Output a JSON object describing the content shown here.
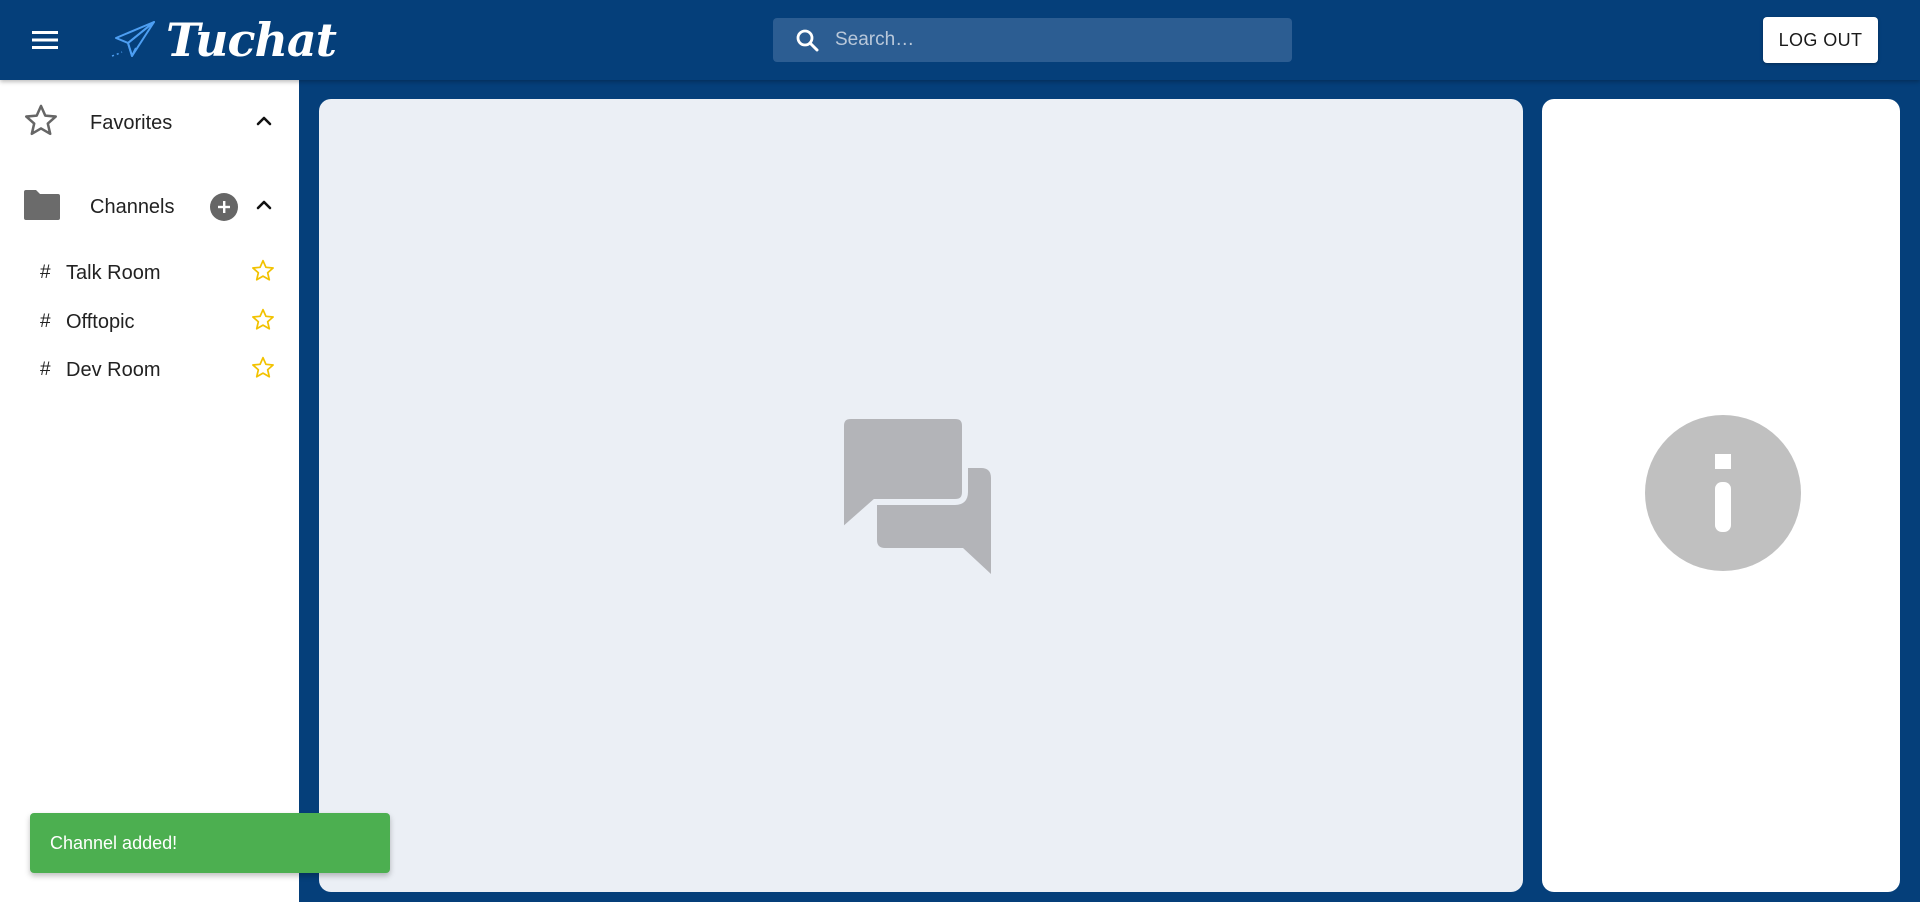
{
  "app": {
    "name": "Tuchat",
    "brand_color": "#053f7a",
    "icons": {
      "menu": "menu-icon",
      "logo": "paper-plane-icon"
    }
  },
  "search": {
    "placeholder": "Search…",
    "value": "",
    "icon": "search-icon"
  },
  "header": {
    "logout_label": "LOG OUT"
  },
  "sidebar": {
    "favorites": {
      "label": "Favorites",
      "icon": "star-outline-icon",
      "expanded": true
    },
    "channels": {
      "label": "Channels",
      "icon": "folder-icon",
      "expanded": true,
      "items": [
        {
          "hash": "#",
          "name": "Talk Room",
          "favorite_icon": "star-outline-icon"
        },
        {
          "hash": "#",
          "name": "Offtopic",
          "favorite_icon": "star-outline-icon"
        },
        {
          "hash": "#",
          "name": "Dev Room",
          "favorite_icon": "star-outline-icon"
        }
      ]
    },
    "star_color": "#f2c200"
  },
  "main": {
    "placeholder_icon": "chat-bubbles-icon",
    "background": "#ebeff5"
  },
  "info_panel": {
    "placeholder_icon": "info-icon"
  },
  "snackbar": {
    "message": "Channel added!",
    "color": "#4caf50"
  }
}
